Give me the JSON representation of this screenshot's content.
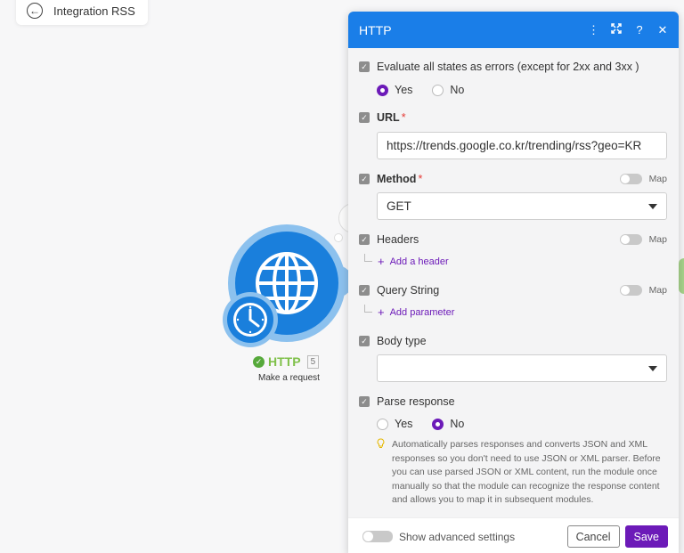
{
  "canvas": {
    "back_label": "Integration RSS"
  },
  "module": {
    "name": "HTTP",
    "id": "5",
    "subtitle": "Make a request",
    "status_color": "#56a93b",
    "brand_color": "#1a7fdc"
  },
  "panel": {
    "title": "HTTP",
    "header_icons": [
      "more-vert-icon",
      "expand-icon",
      "help-icon",
      "close-icon"
    ],
    "evaluate_errors": {
      "label": "Evaluate all states as errors (except for 2xx and 3xx )",
      "options": [
        "Yes",
        "No"
      ],
      "selected": "Yes"
    },
    "url": {
      "label": "URL",
      "required": "*",
      "value": "https://trends.google.co.kr/trending/rss?geo=KR"
    },
    "method": {
      "label": "Method",
      "required": "*",
      "map_label": "Map",
      "value": "GET"
    },
    "headers": {
      "label": "Headers",
      "map_label": "Map",
      "add_label": "Add a header"
    },
    "query_string": {
      "label": "Query String",
      "map_label": "Map",
      "add_label": "Add parameter"
    },
    "body_type": {
      "label": "Body type",
      "value": ""
    },
    "parse_response": {
      "label": "Parse response",
      "options": [
        "Yes",
        "No"
      ],
      "selected": "No",
      "hint": "Automatically parses responses and converts JSON and XML responses so you don't need to use JSON or XML parser. Before you can use parsed JSON or XML content, run the module once manually so that the module can recognize the response content and allows you to map it in subsequent modules."
    },
    "footer": {
      "advanced_label": "Show advanced settings",
      "cancel_label": "Cancel",
      "save_label": "Save"
    },
    "accent_color": "#6c1ab8",
    "header_color": "#1a7ee8"
  }
}
